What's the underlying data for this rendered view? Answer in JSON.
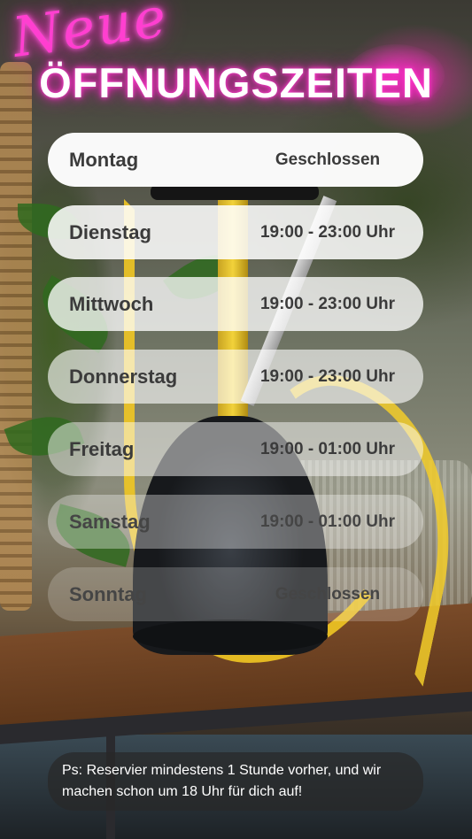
{
  "header": {
    "neon_script": "Neue",
    "title": "ÖFFNUNGSZEITEN"
  },
  "schedule": [
    {
      "day": "Montag",
      "time": "Geschlossen"
    },
    {
      "day": "Dienstag",
      "time": "19:00 - 23:00 Uhr"
    },
    {
      "day": "Mittwoch",
      "time": "19:00 - 23:00 Uhr"
    },
    {
      "day": "Donnerstag",
      "time": "19:00 - 23:00 Uhr"
    },
    {
      "day": "Freitag",
      "time": "19:00 - 01:00 Uhr"
    },
    {
      "day": "Samstag",
      "time": "19:00 - 01:00 Uhr"
    },
    {
      "day": "Sonntag",
      "time": "Geschlossen"
    }
  ],
  "note": "Ps: Reservier mindestens 1 Stunde vorher, und wir machen schon um 18 Uhr für dich auf!",
  "colors": {
    "neon_pink": "#ff3fd0",
    "hose_yellow": "#f1c723",
    "pill_white": "#ffffff",
    "note_dark": "#282828"
  }
}
